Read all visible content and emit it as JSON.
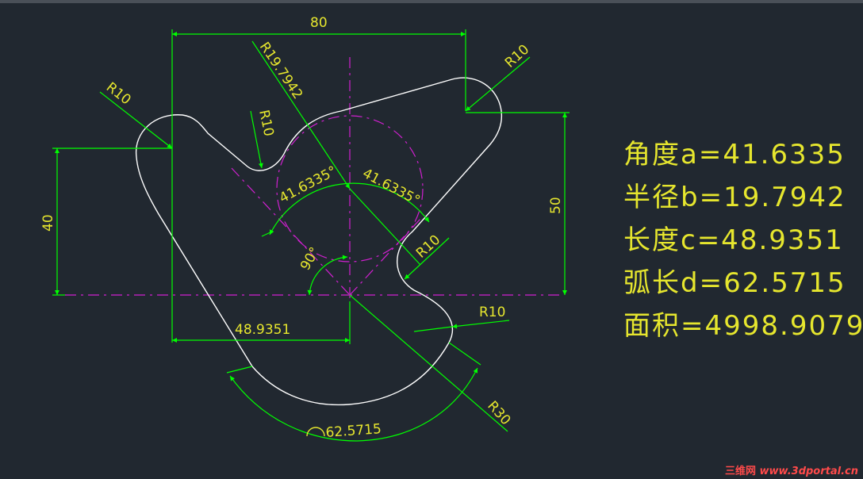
{
  "dimensions": {
    "width_top": "80",
    "height_right": "50",
    "height_left": "40",
    "radius_top_right": "R10",
    "radius_top_left": "R10",
    "radius_mid_left": "R10",
    "radius_circle": "R19.7942",
    "radius_mid_right": "R10",
    "radius_bottom_right": "R10",
    "radius_big": "R30",
    "angle_left": "41.6335°",
    "angle_right": "41.6335°",
    "angle_right_angle": "90°",
    "length_c": "48.9351",
    "arc_length": "62.5715"
  },
  "results": {
    "angle": "角度a=41.6335",
    "radius": "半径b=19.7942",
    "length": "长度c=48.9351",
    "arc": "弧长d=62.5715",
    "area": "面积=4998.9079"
  },
  "watermark": {
    "cn": "三维网",
    "url": "www.3dportal.cn"
  },
  "colors": {
    "background": "#212830",
    "outline": "#ffffff",
    "dimension": "#00ff00",
    "construction": "#d020d0",
    "text": "#e6e62e"
  }
}
